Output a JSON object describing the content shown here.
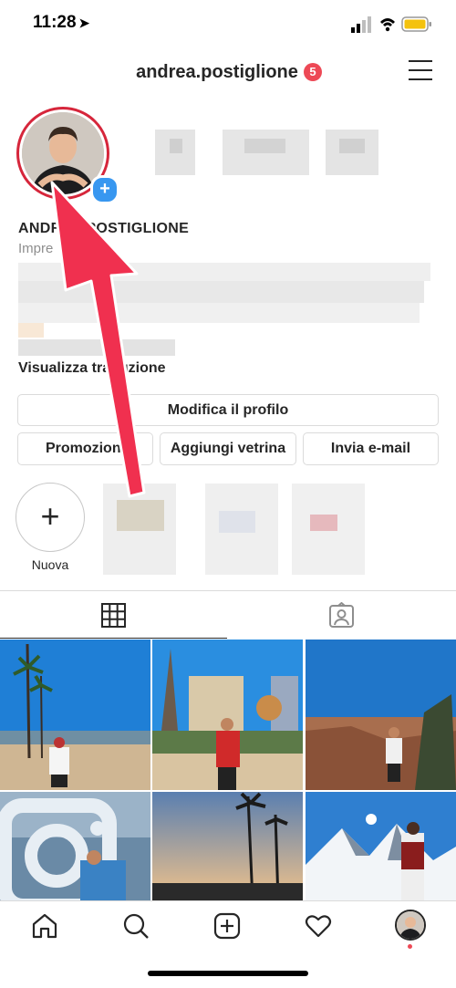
{
  "status_bar": {
    "time": "11:28"
  },
  "header": {
    "username": "andrea.postiglione",
    "notification_count": "5"
  },
  "profile": {
    "name": "ANDREA POSTIGLIONE",
    "category": "Impre",
    "see_translation": "Visualizza traduzione"
  },
  "buttons": {
    "edit_profile": "Modifica il profilo",
    "promotions": "Promozioni",
    "add_shop": "Aggiungi vetrina",
    "email": "Invia e-mail"
  },
  "highlights": {
    "new_label": "Nuova"
  },
  "icons": {
    "menu": "hamburger-menu-icon",
    "grid": "grid-icon",
    "tagged": "tagged-photos-icon",
    "home": "home-icon",
    "search": "search-icon",
    "add": "add-post-icon",
    "activity": "heart-icon",
    "profile": "profile-avatar-icon"
  },
  "colors": {
    "badge": "#ed4956",
    "story_ring": "#d6263b",
    "add_badge": "#3897f0",
    "arrow": "#f0304f"
  }
}
